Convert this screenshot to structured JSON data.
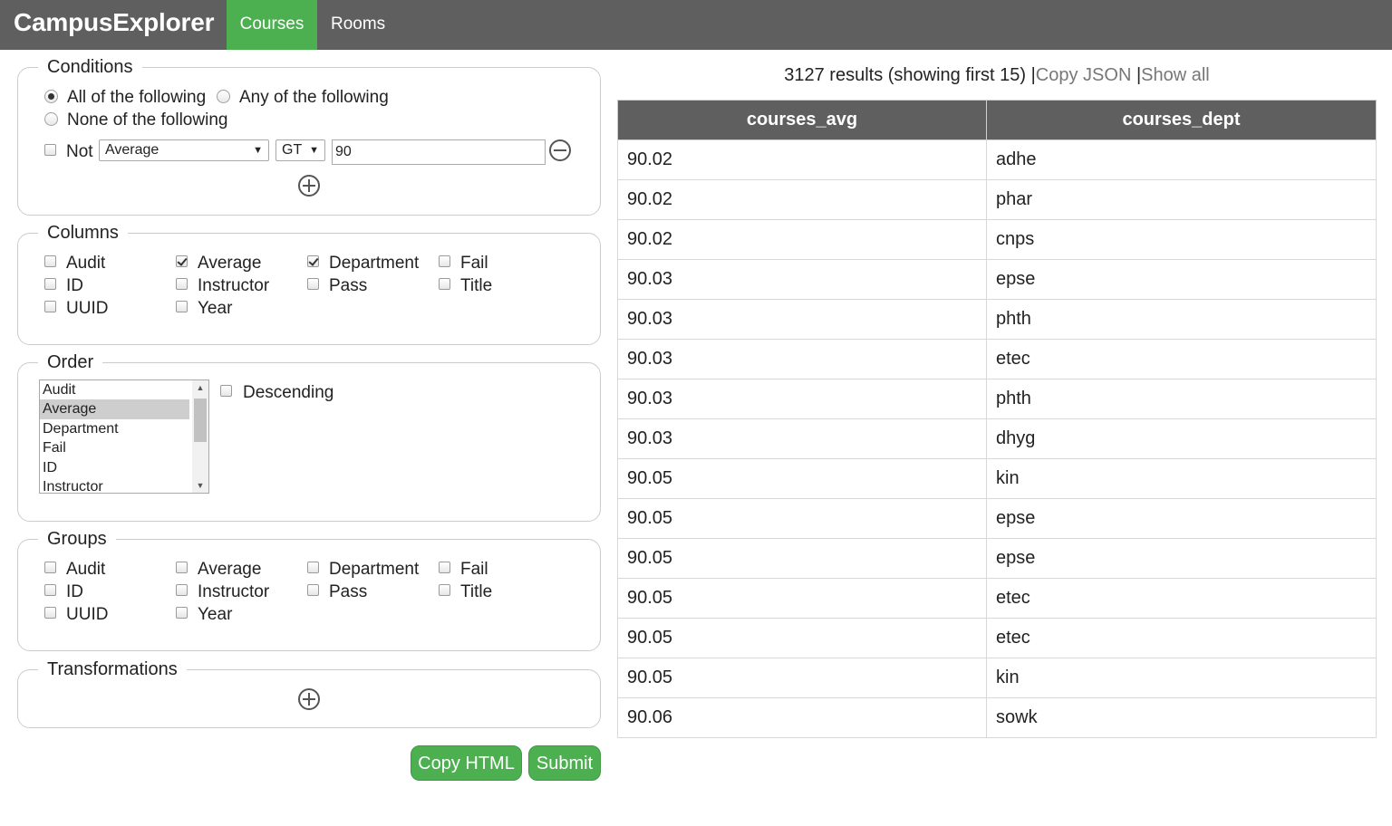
{
  "app": {
    "brand": "CampusExplorer"
  },
  "nav": {
    "tabs": [
      {
        "label": "Courses",
        "active": true
      },
      {
        "label": "Rooms",
        "active": false
      }
    ]
  },
  "conditions": {
    "legend": "Conditions",
    "radios": [
      {
        "label": "All of the following",
        "checked": true
      },
      {
        "label": "Any of the following",
        "checked": false
      },
      {
        "label": "None of the following",
        "checked": false
      }
    ],
    "row": {
      "not_label": "Not",
      "not_checked": false,
      "field": "Average",
      "operator": "GT",
      "value": "90"
    }
  },
  "columns": {
    "legend": "Columns",
    "items": [
      {
        "label": "Audit",
        "checked": false
      },
      {
        "label": "Average",
        "checked": true
      },
      {
        "label": "Department",
        "checked": true
      },
      {
        "label": "Fail",
        "checked": false
      },
      {
        "label": "ID",
        "checked": false
      },
      {
        "label": "Instructor",
        "checked": false
      },
      {
        "label": "Pass",
        "checked": false
      },
      {
        "label": "Title",
        "checked": false
      },
      {
        "label": "UUID",
        "checked": false
      },
      {
        "label": "Year",
        "checked": false
      }
    ]
  },
  "order": {
    "legend": "Order",
    "options": [
      "Audit",
      "Average",
      "Department",
      "Fail",
      "ID",
      "Instructor"
    ],
    "selected": "Average",
    "descending_label": "Descending",
    "descending_checked": false
  },
  "groups": {
    "legend": "Groups",
    "items": [
      {
        "label": "Audit",
        "checked": false
      },
      {
        "label": "Average",
        "checked": false
      },
      {
        "label": "Department",
        "checked": false
      },
      {
        "label": "Fail",
        "checked": false
      },
      {
        "label": "ID",
        "checked": false
      },
      {
        "label": "Instructor",
        "checked": false
      },
      {
        "label": "Pass",
        "checked": false
      },
      {
        "label": "Title",
        "checked": false
      },
      {
        "label": "UUID",
        "checked": false
      },
      {
        "label": "Year",
        "checked": false
      }
    ]
  },
  "transformations": {
    "legend": "Transformations"
  },
  "buttons": {
    "copy_html": "Copy HTML",
    "submit": "Submit"
  },
  "results": {
    "summary": "3127 results (showing first 15)",
    "separator": "|",
    "copy_json": "Copy JSON",
    "show_all": "Show all",
    "columns": [
      "courses_avg",
      "courses_dept"
    ],
    "rows": [
      [
        "90.02",
        "adhe"
      ],
      [
        "90.02",
        "phar"
      ],
      [
        "90.02",
        "cnps"
      ],
      [
        "90.03",
        "epse"
      ],
      [
        "90.03",
        "phth"
      ],
      [
        "90.03",
        "etec"
      ],
      [
        "90.03",
        "phth"
      ],
      [
        "90.03",
        "dhyg"
      ],
      [
        "90.05",
        "kin"
      ],
      [
        "90.05",
        "epse"
      ],
      [
        "90.05",
        "epse"
      ],
      [
        "90.05",
        "etec"
      ],
      [
        "90.05",
        "etec"
      ],
      [
        "90.05",
        "kin"
      ],
      [
        "90.06",
        "sowk"
      ]
    ]
  }
}
